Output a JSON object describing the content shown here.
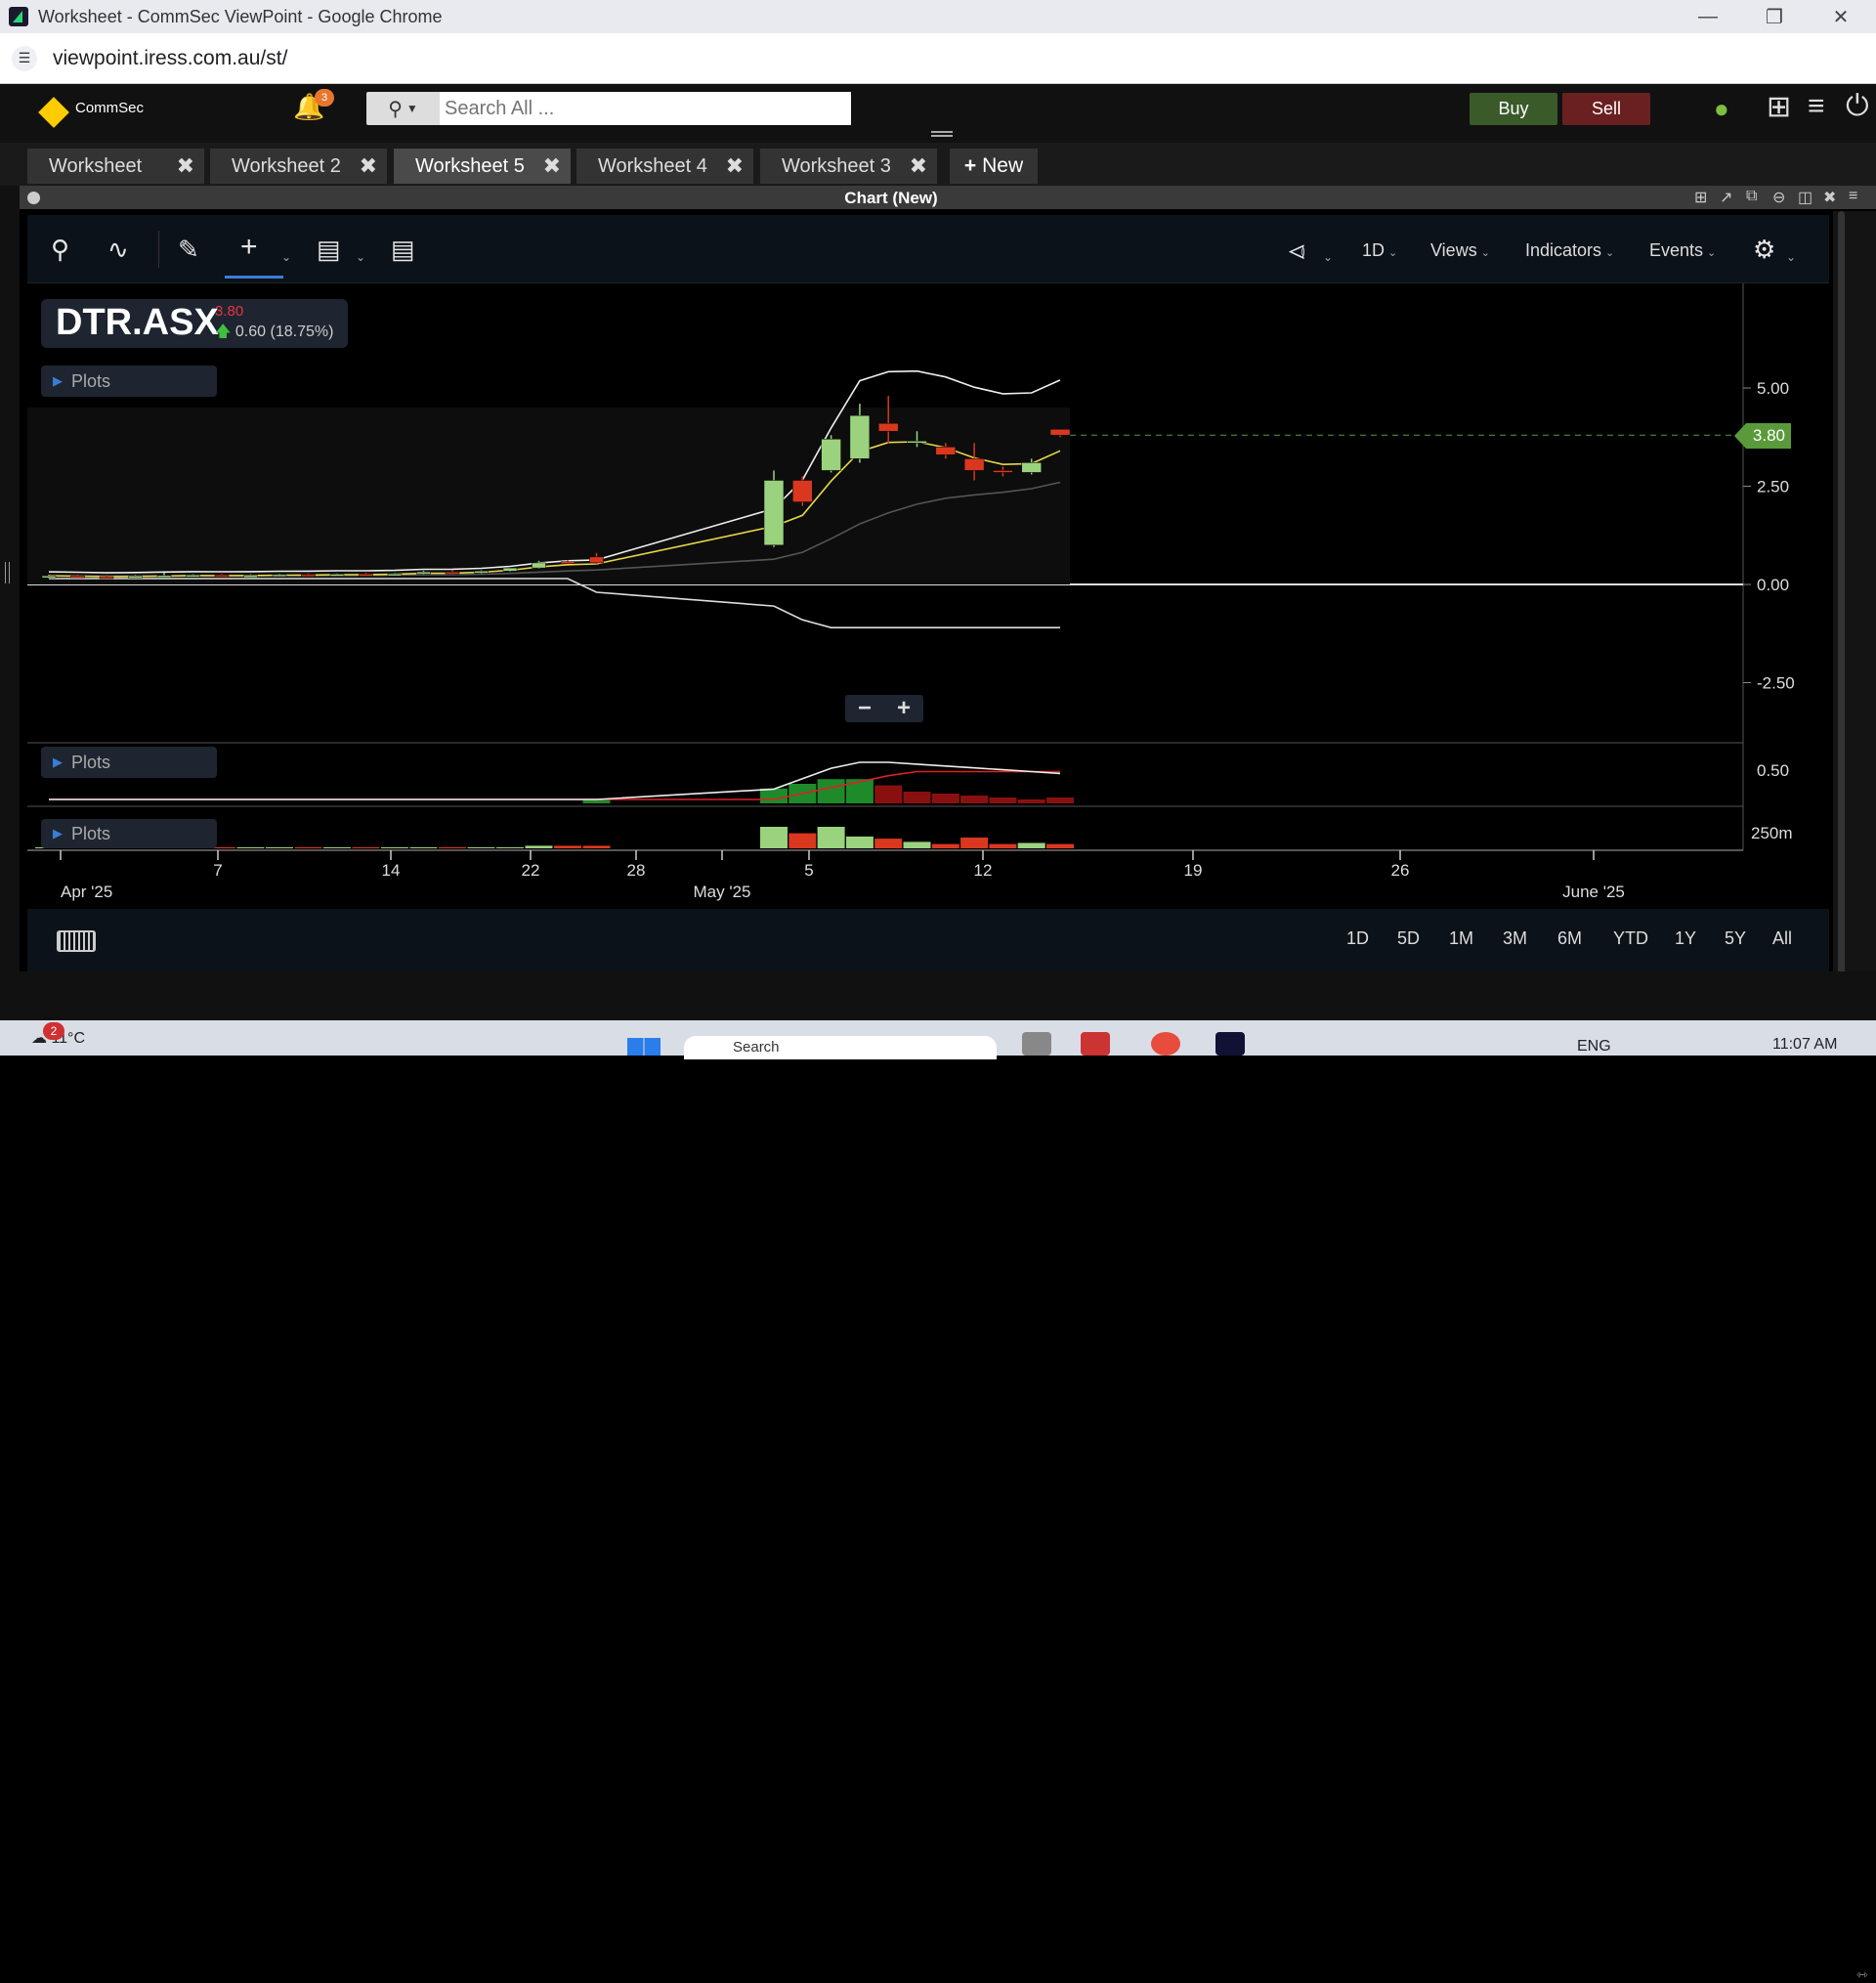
{
  "window": {
    "title": "Worksheet - CommSec ViewPoint - Google Chrome",
    "url": "viewpoint.iress.com.au/st/"
  },
  "header": {
    "logo_text": "CommSec",
    "notification_count": "3",
    "search_placeholder": "Search All ...",
    "buy_label": "Buy",
    "sell_label": "Sell"
  },
  "tabs": [
    {
      "label": "Worksheet",
      "active": false
    },
    {
      "label": "Worksheet 2",
      "active": false
    },
    {
      "label": "Worksheet 5",
      "active": true
    },
    {
      "label": "Worksheet 4",
      "active": false
    },
    {
      "label": "Worksheet 3",
      "active": false
    }
  ],
  "new_tab_label": "New",
  "panel": {
    "title": "Chart (New)"
  },
  "toolbar": {
    "interval": "1D",
    "views": "Views",
    "indicators": "Indicators",
    "events": "Events"
  },
  "symbol": {
    "code": "DTR.ASX",
    "price": "3.80",
    "change": "0.60 (18.75%)"
  },
  "plots_label": "Plots",
  "current_price_tag": "3.80",
  "price_axis_labels": [
    "5.00",
    "2.50",
    "0.00",
    "-2.50"
  ],
  "sub_axis_labels": [
    "0.50",
    "250m"
  ],
  "x_axis": {
    "labels": [
      "Apr '25",
      "7",
      "14",
      "22",
      "28",
      "May '25",
      "5",
      "12",
      "19",
      "26",
      "June '25"
    ]
  },
  "range_buttons": [
    "1D",
    "5D",
    "1M",
    "3M",
    "6M",
    "YTD",
    "1Y",
    "5Y",
    "All"
  ],
  "colors": {
    "up_candle": "#9ad27e",
    "down_candle": "#d9381e",
    "accent": "#3b7dd8",
    "price_tag": "#5a9a3a",
    "buy": "#3a5a2a",
    "sell": "#6a2020"
  },
  "chart_data": {
    "type": "candlestick",
    "symbol": "DTR.ASX",
    "interval": "1D",
    "x": [
      "Apr 1",
      "Apr 2",
      "Apr 3",
      "Apr 4",
      "Apr 7",
      "Apr 8",
      "Apr 9",
      "Apr 10",
      "Apr 11",
      "Apr 14",
      "Apr 15",
      "Apr 16",
      "Apr 17",
      "Apr 22",
      "Apr 23",
      "Apr 24",
      "Apr 28",
      "Apr 29",
      "Apr 30",
      "May 1",
      "May 2",
      "May 5",
      "May 6",
      "May 7",
      "May 8",
      "May 9",
      "May 12",
      "May 13",
      "May 14",
      "May 15",
      "May 16"
    ],
    "ohlc": [
      [
        0.2,
        0.25,
        0.15,
        0.22
      ],
      [
        0.22,
        0.25,
        0.18,
        0.2
      ],
      [
        0.2,
        0.24,
        0.16,
        0.18
      ],
      [
        0.2,
        0.24,
        0.17,
        0.21
      ],
      [
        0.21,
        0.3,
        0.18,
        0.23
      ],
      [
        0.23,
        0.26,
        0.2,
        0.24
      ],
      [
        0.24,
        0.27,
        0.21,
        0.22
      ],
      [
        0.22,
        0.26,
        0.2,
        0.23
      ],
      [
        0.23,
        0.27,
        0.21,
        0.25
      ],
      [
        0.25,
        0.28,
        0.22,
        0.24
      ],
      [
        0.24,
        0.28,
        0.22,
        0.26
      ],
      [
        0.26,
        0.3,
        0.24,
        0.25
      ],
      [
        0.25,
        0.29,
        0.23,
        0.27
      ],
      [
        0.27,
        0.35,
        0.25,
        0.32
      ],
      [
        0.32,
        0.36,
        0.28,
        0.29
      ],
      [
        0.29,
        0.36,
        0.27,
        0.34
      ],
      [
        0.34,
        0.4,
        0.32,
        0.42
      ],
      [
        0.42,
        0.6,
        0.4,
        0.55
      ],
      [
        0.58,
        0.62,
        0.55,
        0.57
      ],
      [
        0.7,
        0.8,
        0.52,
        0.55
      ],
      [
        1.0,
        2.9,
        0.95,
        2.65
      ],
      [
        2.65,
        2.75,
        2.0,
        2.1
      ],
      [
        2.9,
        3.8,
        2.85,
        3.7
      ],
      [
        3.2,
        4.6,
        3.1,
        4.3
      ],
      [
        4.1,
        4.8,
        3.6,
        3.9
      ],
      [
        3.65,
        3.9,
        3.5,
        3.65
      ],
      [
        3.5,
        3.6,
        3.2,
        3.3
      ],
      [
        3.2,
        3.6,
        2.65,
        2.9
      ],
      [
        2.9,
        3.0,
        2.75,
        2.85
      ],
      [
        2.85,
        3.2,
        2.8,
        3.1
      ],
      [
        3.95,
        3.95,
        3.75,
        3.8
      ]
    ],
    "last_price": 3.8,
    "ylim": [
      -3.5,
      6.0
    ],
    "y_ticks": [
      5.0,
      2.5,
      0.0,
      -2.5
    ],
    "sub_panel_ticks": [
      "0.50",
      "250m"
    ]
  }
}
